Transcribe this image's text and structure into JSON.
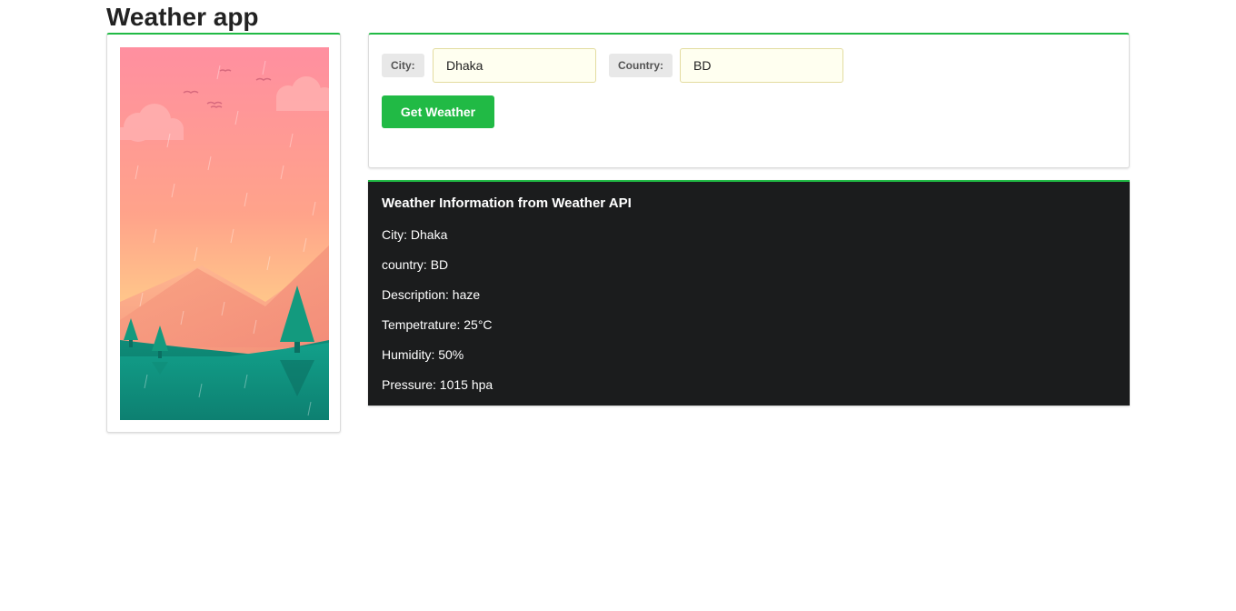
{
  "header": {
    "title": "Weather app"
  },
  "form": {
    "city_label": "City:",
    "city_value": "Dhaka",
    "country_label": "Country:",
    "country_value": "BD",
    "submit_label": "Get Weather"
  },
  "weather": {
    "title": "Weather Information from Weather API",
    "lines": [
      "City: Dhaka",
      "country: BD",
      "Description: haze",
      "Tempetrature: 25°C",
      "Humidity: 50%",
      "Pressure: 1015 hpa"
    ]
  },
  "colors": {
    "accent": "#21ba45",
    "info_background": "#1b1c1d",
    "input_background": "#fffff0"
  },
  "illustration": {
    "icon": "landscape-illustration"
  }
}
